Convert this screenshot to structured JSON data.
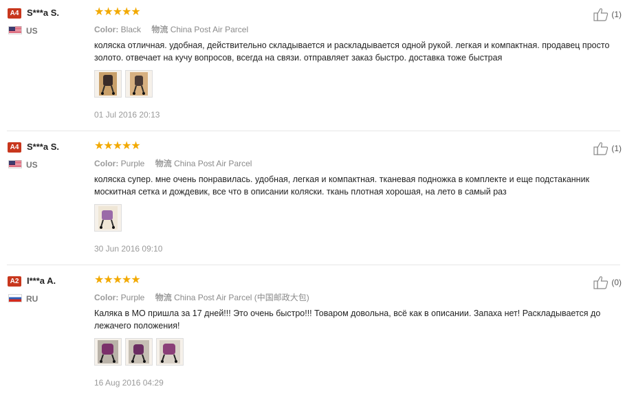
{
  "reviews": [
    {
      "badge": "A4",
      "user": "S***a S.",
      "country_code": "US",
      "country": "US",
      "rating": 5,
      "stars": "★★★★★",
      "color_key": "Color:",
      "color_value": "Black",
      "shipping_key": "物流",
      "shipping_value": "China Post Air Parcel",
      "text": "коляска отличная. удобная, действительно складывается и раскладывается одной рукой. легкая и компактная. продавец просто золото. отвечает на кучу вопросов, всегда на связи. отправляет заказ быстро. доставка тоже быстрая",
      "photos": [
        "stroller-photo",
        "stroller-photo"
      ],
      "date": "01 Jul 2016 20:13",
      "helpful_count": "(1)"
    },
    {
      "badge": "A4",
      "user": "S***a S.",
      "country_code": "US",
      "country": "US",
      "rating": 5,
      "stars": "★★★★★",
      "color_key": "Color:",
      "color_value": "Purple",
      "shipping_key": "物流",
      "shipping_value": "China Post Air Parcel",
      "text": "коляска супер. мне очень понравилась. удобная, легкая и компактная. тканевая подножка в комплекте и еще подстаканник москитная сетка и дождевик, все что в описании коляски. ткань плотная хорошая, на лето в самый раз",
      "photos": [
        "stroller-photo"
      ],
      "date": "30 Jun 2016 09:10",
      "helpful_count": "(1)"
    },
    {
      "badge": "A2",
      "user": "I***a A.",
      "country_code": "RU",
      "country": "RU",
      "rating": 5,
      "stars": "★★★★★",
      "color_key": "Color:",
      "color_value": "Purple",
      "shipping_key": "物流",
      "shipping_value": "China Post Air Parcel (中国邮政大包)",
      "text": "Каляка в МО пришла за 17 дней!!! Это очень быстро!!! Товаром довольна, всё как в описании. Запаха нет! Раскладывается до лежачего положения!",
      "photos": [
        "stroller-photo",
        "stroller-photo",
        "stroller-photo"
      ],
      "date": "16 Aug 2016 04:29",
      "helpful_count": "(0)"
    }
  ],
  "colors": {
    "badge": "#c8371d",
    "star": "#f2a900",
    "meta_text": "#8a8a8a",
    "divider": "#e6e6e6"
  },
  "icons": {
    "helpful": "thumbs-up-icon",
    "star": "star-icon"
  }
}
